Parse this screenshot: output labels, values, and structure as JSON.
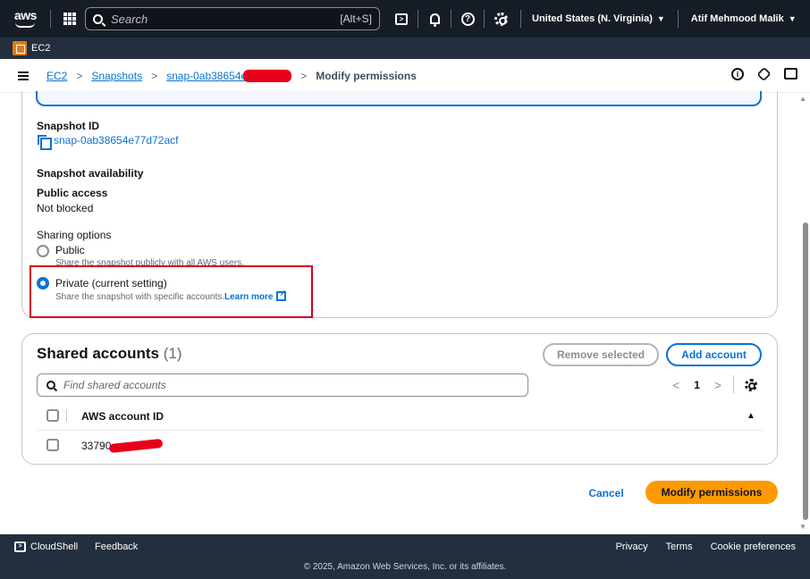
{
  "topnav": {
    "logo_text": "aws",
    "search_placeholder": "Search",
    "search_shortcut": "[Alt+S]",
    "region": "United States (N. Virginia)",
    "user": "Atif Mehmood Malik"
  },
  "servicebar": {
    "service_label": "EC2"
  },
  "breadcrumb": {
    "items": [
      "EC2",
      "Snapshots",
      "snap-0ab38654e"
    ],
    "current": "Modify permissions"
  },
  "snapshot": {
    "id_label": "Snapshot ID",
    "id_value": "snap-0ab38654e77d72acf",
    "availability_label": "Snapshot availability",
    "public_access_label": "Public access",
    "public_access_value": "Not blocked",
    "sharing_label": "Sharing options",
    "options": [
      {
        "label": "Public",
        "desc": "Share the snapshot publicly with all AWS users.",
        "checked": false
      },
      {
        "label": "Private (current setting)",
        "desc": "Share the snapshot with specific accounts.",
        "checked": true
      }
    ],
    "learn_more": "Learn more"
  },
  "shared": {
    "title": "Shared accounts",
    "count": "(1)",
    "remove_button": "Remove selected",
    "add_button": "Add account",
    "find_placeholder": "Find shared accounts",
    "page": "1",
    "column_header": "AWS account ID",
    "rows": [
      {
        "account_id": "33790"
      }
    ]
  },
  "actions": {
    "cancel": "Cancel",
    "modify": "Modify permissions"
  },
  "footer": {
    "cloudshell": "CloudShell",
    "feedback": "Feedback",
    "links": [
      "Privacy",
      "Terms",
      "Cookie preferences"
    ],
    "copyright": "© 2025, Amazon Web Services, Inc. or its affiliates."
  },
  "colors": {
    "accent": "#0972d3",
    "primary_button": "#ff9900",
    "nav_bg": "#161d26",
    "highlight": "#d0021b",
    "redaction": "#e8001a"
  }
}
